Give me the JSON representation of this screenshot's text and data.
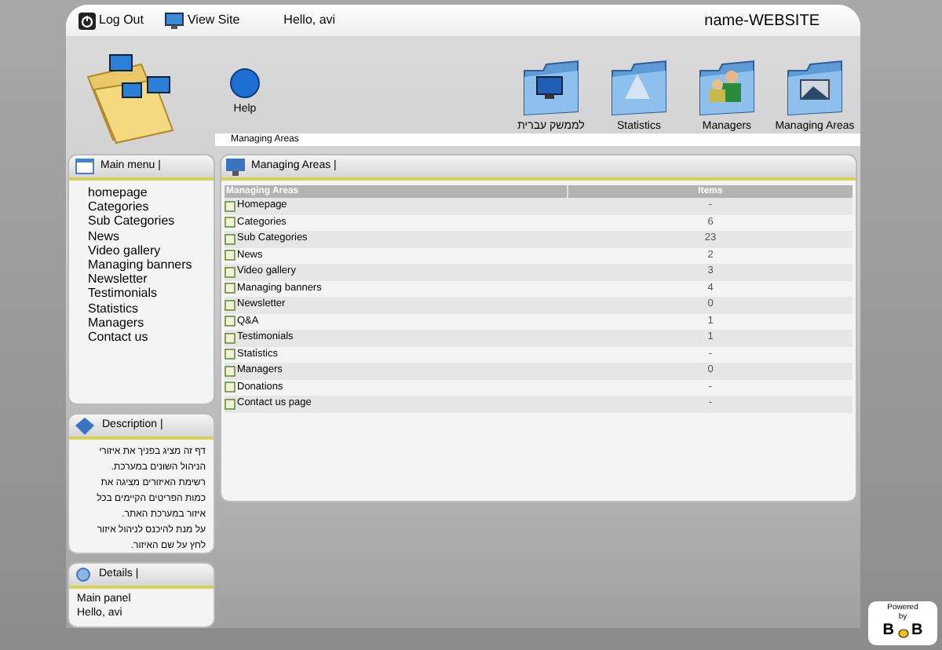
{
  "top_bar": {
    "links": [
      {
        "label": "Log Out",
        "kind": "power"
      },
      {
        "label": "View Site",
        "kind": "monitor"
      }
    ],
    "greeting": "Hello, avi",
    "site_name": "name-WEBSITE"
  },
  "help": {
    "label": "Help"
  },
  "nav_icons": [
    {
      "label": "לממשק עברית",
      "kind": "monitor"
    },
    {
      "label": "Statistics",
      "kind": "stats"
    },
    {
      "label": "Managers",
      "kind": "people"
    },
    {
      "label": "Managing Areas",
      "kind": "photo"
    }
  ],
  "breadcrumb": "Managing Areas",
  "main_menu": {
    "title": "Main menu |",
    "items": [
      "homepage",
      "Categories",
      "Sub Categories",
      "News",
      "Video gallery",
      "Managing banners",
      "Newsletter",
      "Testimonials",
      "Statistics",
      "Managers",
      "Contact us"
    ]
  },
  "description": {
    "title": "Description |",
    "lines": [
      "דף זה מציג בפניך את איזורי",
      "הניהול השונים במערכת.",
      "רשימת האיזורים מציגה את",
      "כמות הפריטים הקיימים בכל",
      "איזור במערכת האתר.",
      "על מנת להיכנס לניהול איזור",
      "לחץ על שם האיזור."
    ]
  },
  "details": {
    "title": "Details |",
    "lines": [
      "Main panel",
      "Hello, avi"
    ]
  },
  "panel": {
    "title": "Managing Areas |",
    "columns": [
      "Managing Areas",
      "Items"
    ],
    "rows": [
      {
        "name": "Homepage",
        "items": "-"
      },
      {
        "name": "Categories",
        "items": "6"
      },
      {
        "name": "Sub Categories",
        "items": "23"
      },
      {
        "name": "News",
        "items": "2"
      },
      {
        "name": "Video gallery",
        "items": "3"
      },
      {
        "name": "Managing banners",
        "items": "4"
      },
      {
        "name": "Newsletter",
        "items": "0"
      },
      {
        "name": "Q&A",
        "items": "1"
      },
      {
        "name": "Testimonials",
        "items": "1"
      },
      {
        "name": "Statistics",
        "items": "-"
      },
      {
        "name": "Managers",
        "items": "0"
      },
      {
        "name": "Donations",
        "items": "-"
      },
      {
        "name": "Contact us page",
        "items": "-"
      }
    ]
  },
  "powered": {
    "line_1": "Powered",
    "line_2": "by",
    "letter_1": "B",
    "letter_2": "B"
  }
}
